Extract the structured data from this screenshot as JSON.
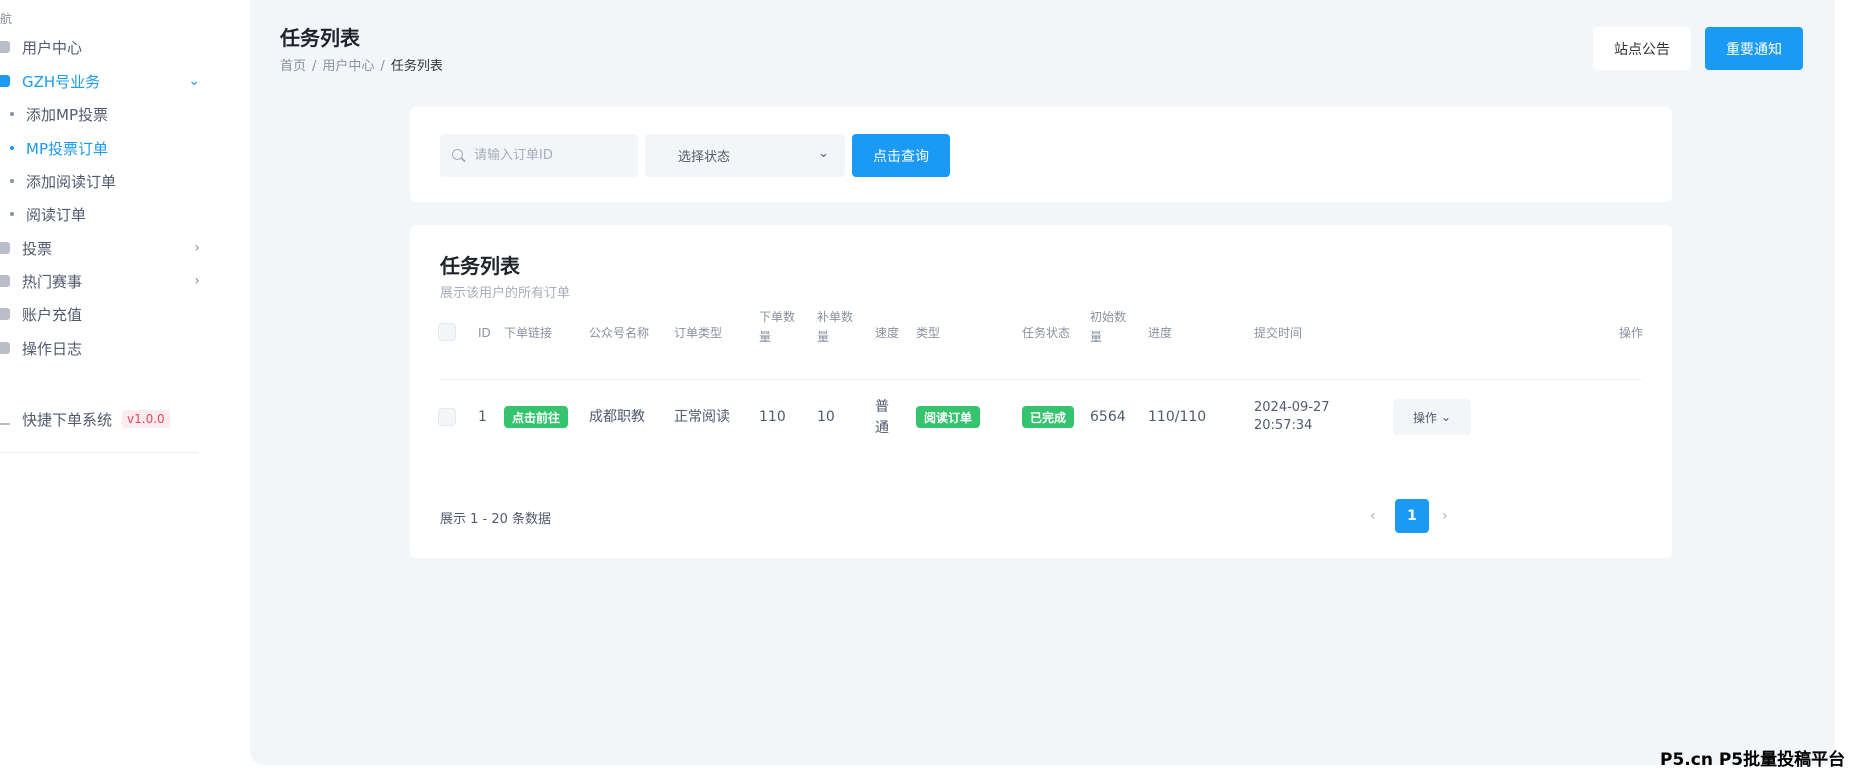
{
  "sidebar": {
    "heading": "航",
    "items": [
      {
        "label": "用户中心",
        "icon": "user-icon"
      },
      {
        "label": "GZH号业务",
        "icon": "business-icon",
        "expanded": true
      },
      {
        "label": "投票",
        "icon": "vote-icon"
      },
      {
        "label": "热门赛事",
        "icon": "trophy-icon"
      },
      {
        "label": "账户充值",
        "icon": "wallet-icon"
      },
      {
        "label": "操作日志",
        "icon": "log-icon"
      }
    ],
    "sub_items": [
      {
        "label": "添加MP投票"
      },
      {
        "label": "MP投票订单",
        "active": true
      },
      {
        "label": "添加阅读订单"
      },
      {
        "label": "阅读订单"
      }
    ],
    "system": {
      "label": "快捷下单系统",
      "version": "v1.0.0"
    }
  },
  "header": {
    "title": "任务列表",
    "breadcrumb": [
      "首页",
      "用户中心",
      "任务列表"
    ],
    "notice_button": "站点公告",
    "important_button": "重要通知"
  },
  "filters": {
    "search_placeholder": "请输入订单ID",
    "status_select": "选择状态",
    "query_button": "点击查询"
  },
  "list": {
    "title": "任务列表",
    "subtitle": "展示该用户的所有订单",
    "columns": {
      "id": "ID",
      "link": "下单链接",
      "account": "公众号名称",
      "order_type": "订单类型",
      "qty": "下单数量",
      "extra": "补单数量",
      "speed": "速度",
      "type": "类型",
      "status": "任务状态",
      "initial": "初始数量",
      "progress": "进度",
      "time": "提交时间",
      "action": "操作"
    },
    "rows": [
      {
        "id": "1",
        "link": "点击前往",
        "account": "成都职教",
        "order_type": "正常阅读",
        "qty": "110",
        "extra": "10",
        "speed": "普通",
        "type": "阅读订单",
        "status": "已完成",
        "initial": "6564",
        "progress": "110/110",
        "date": "2024-09-27",
        "time": "20:57:34",
        "action": "操作"
      }
    ],
    "pagination": {
      "info": "展示 1 - 20 条数据",
      "current_page": "1"
    }
  },
  "watermark": "P5.cn P5批量投稿平台",
  "colors": {
    "accent": "#1a9af5",
    "success": "#36c36e",
    "background": "#f3f6f9"
  }
}
